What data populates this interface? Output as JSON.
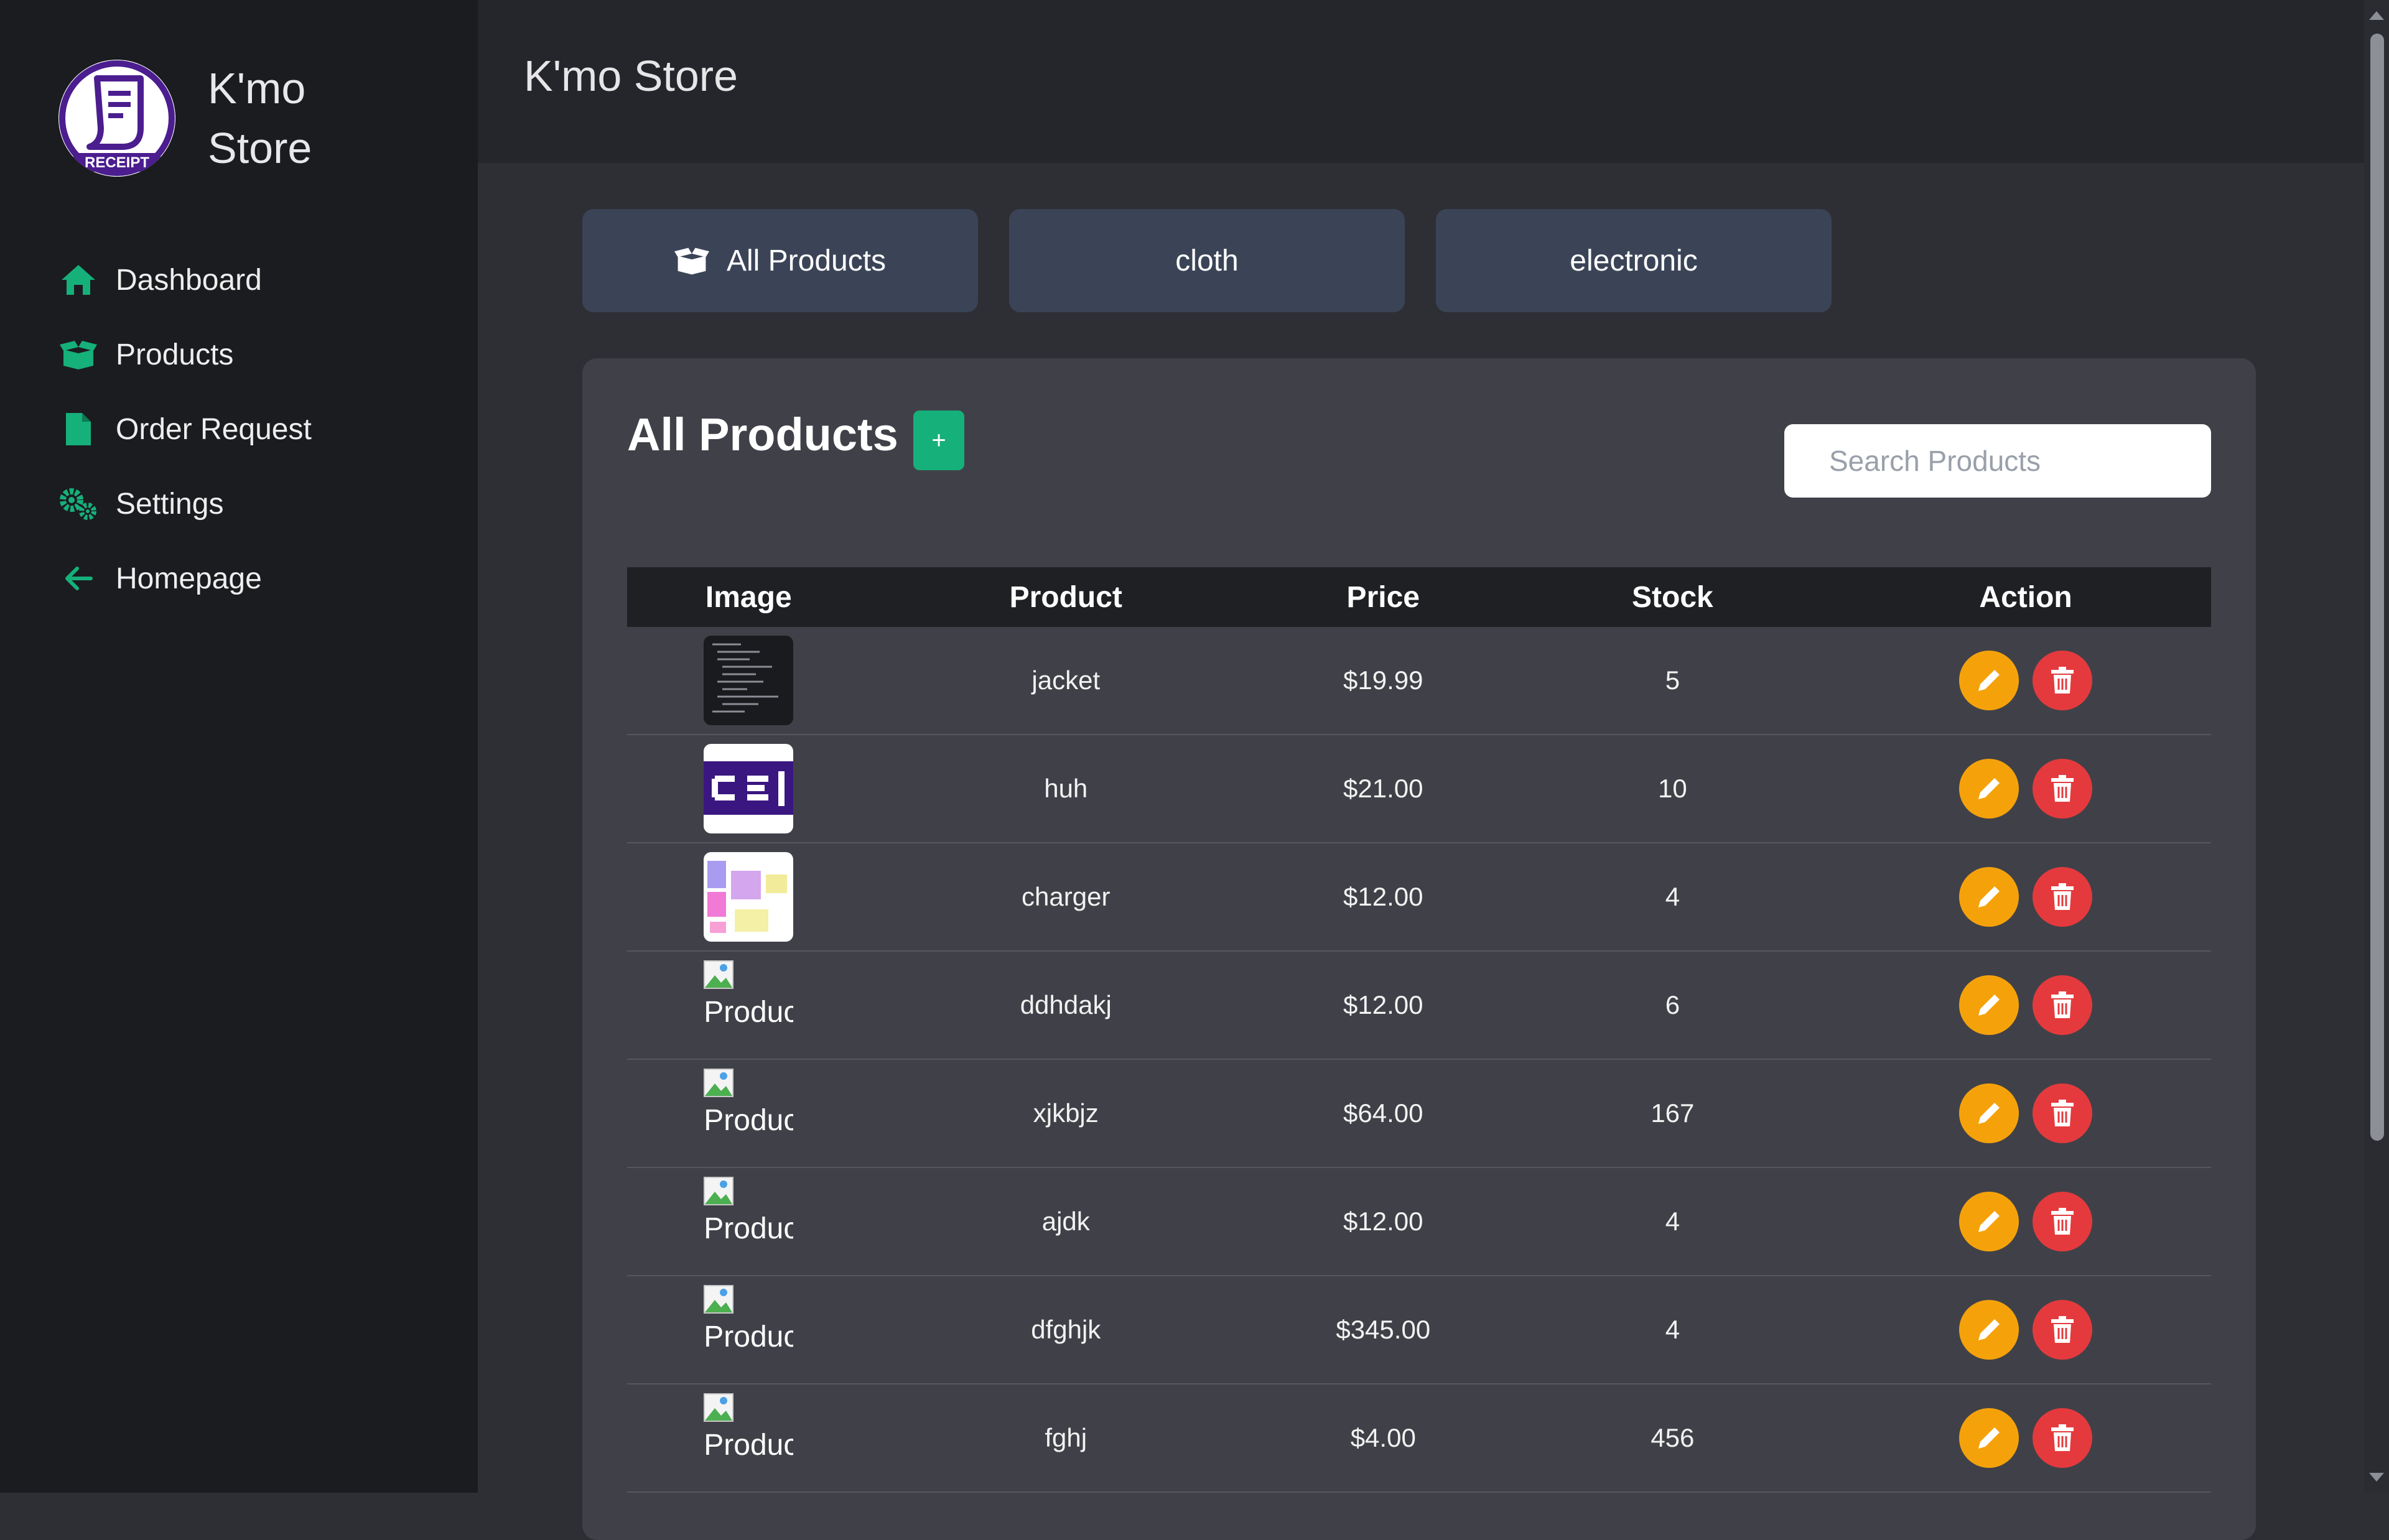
{
  "sidebar": {
    "brand_name": "K'mo Store",
    "logo_text": "RECEIPT",
    "items": [
      {
        "label": "Dashboard",
        "icon": "home-icon"
      },
      {
        "label": "Products",
        "icon": "box-open-icon"
      },
      {
        "label": "Order Request",
        "icon": "file-icon"
      },
      {
        "label": "Settings",
        "icon": "gears-icon"
      },
      {
        "label": "Homepage",
        "icon": "arrow-left-icon"
      }
    ]
  },
  "header": {
    "title": "K'mo Store"
  },
  "tabs": [
    {
      "label": "All Products",
      "icon": "box-open-icon"
    },
    {
      "label": "cloth"
    },
    {
      "label": "electronic"
    }
  ],
  "panel": {
    "title": "All Products",
    "add_label": "+",
    "search_placeholder": "Search Products"
  },
  "table": {
    "columns": [
      "Image",
      "Product",
      "Price",
      "Stock",
      "Action"
    ],
    "rows": [
      {
        "image": "code-screenshot-thumbnail",
        "product": "jacket",
        "price": "$19.99",
        "stock": "5"
      },
      {
        "image": "logo-thumbnail",
        "product": "huh",
        "price": "$21.00",
        "stock": "10"
      },
      {
        "image": "diagram-thumbnail",
        "product": "charger",
        "price": "$12.00",
        "stock": "4"
      },
      {
        "image": "broken",
        "alt": "Product",
        "product": "ddhdakj",
        "price": "$12.00",
        "stock": "6"
      },
      {
        "image": "broken",
        "alt": "Product",
        "product": "xjkbjz",
        "price": "$64.00",
        "stock": "167"
      },
      {
        "image": "broken",
        "alt": "Product",
        "product": "ajdk",
        "price": "$12.00",
        "stock": "4"
      },
      {
        "image": "broken",
        "alt": "Product",
        "product": "dfghjk",
        "price": "$345.00",
        "stock": "4"
      },
      {
        "image": "broken",
        "alt": "Product",
        "product": "fghj",
        "price": "$4.00",
        "stock": "456"
      }
    ]
  },
  "colors": {
    "accent": "#16b07a",
    "edit": "#f5a20a",
    "delete": "#e43a3d",
    "tab": "#3b4457",
    "logo": "#4b1d8f"
  }
}
